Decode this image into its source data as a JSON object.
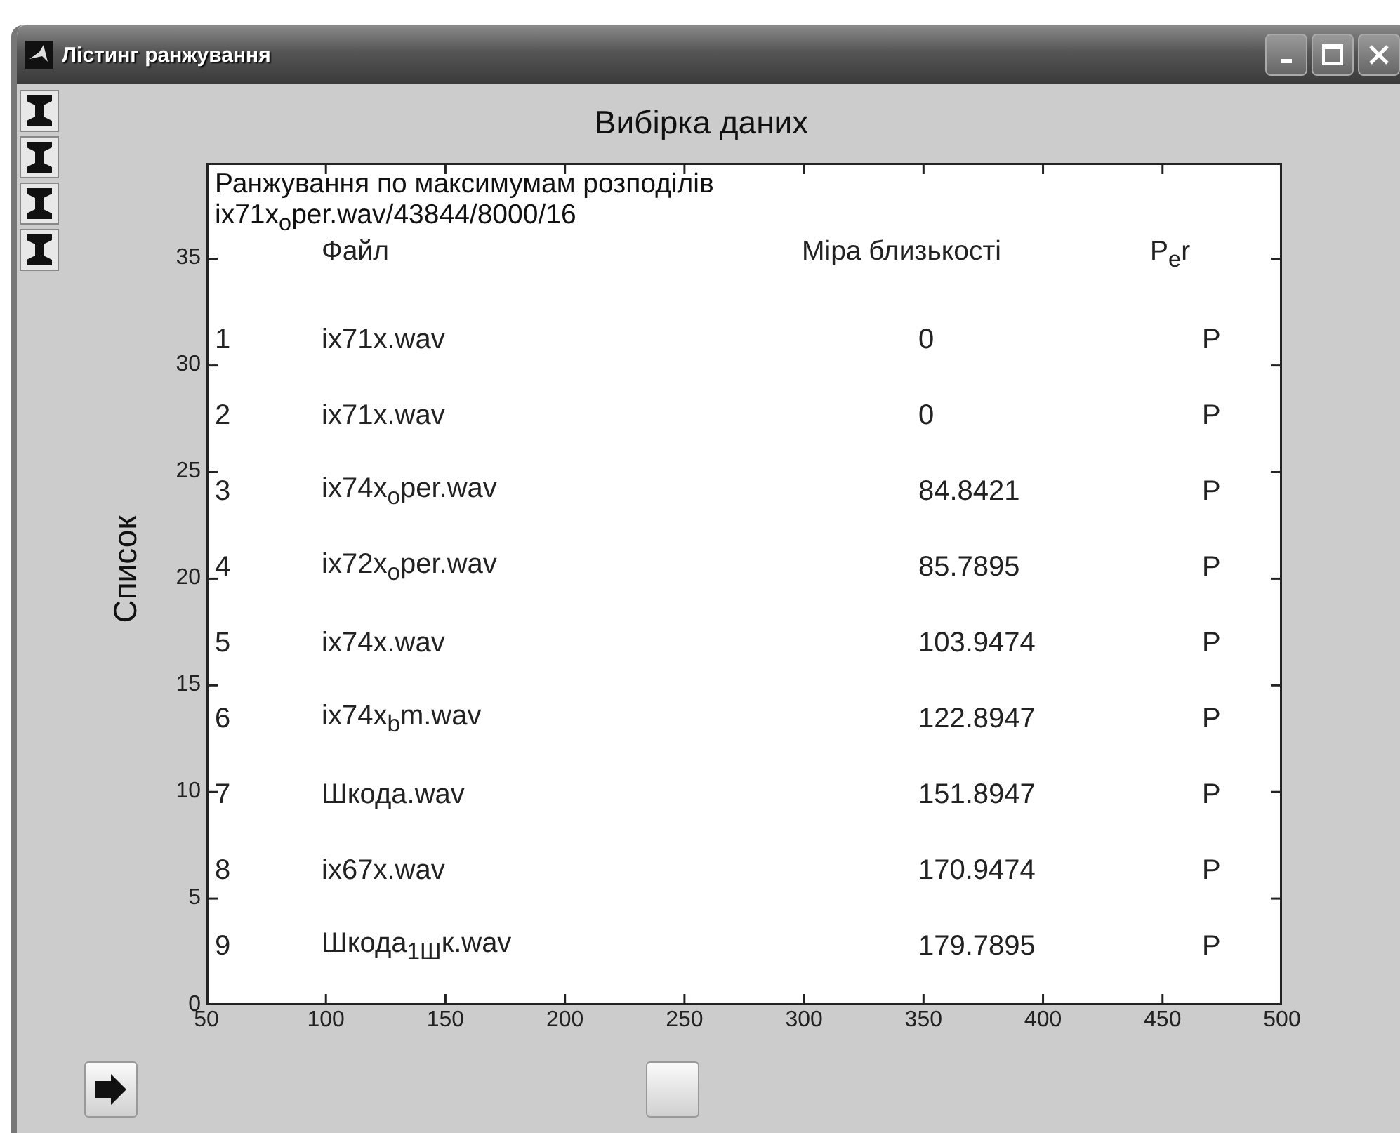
{
  "window": {
    "title": "Лістинг ранжування"
  },
  "plot": {
    "title": "Вибірка даних",
    "ylabel": "Список",
    "xticks": [
      "50",
      "100",
      "150",
      "200",
      "250",
      "300",
      "350",
      "400",
      "450",
      "500"
    ],
    "yticks": [
      "35",
      "30",
      "25",
      "20",
      "15",
      "10",
      "5",
      "0"
    ],
    "heading": [
      "Ранжування по максимумам розподілів",
      "ix71x$_{o}$per.wav/43844/8000/16"
    ],
    "columns": [
      "Файл",
      "Міра близькості",
      "P$_{e}$r"
    ],
    "rows": [
      {
        "rank": "1",
        "file": "ix71x.wav",
        "measure": "0",
        "flag": "P"
      },
      {
        "rank": "2",
        "file": "ix71x.wav",
        "measure": "0",
        "flag": "P"
      },
      {
        "rank": "3",
        "file": "ix74x$_{o}$per.wav",
        "measure": "84.8421",
        "flag": "P"
      },
      {
        "rank": "4",
        "file": "ix72x$_{o}$per.wav",
        "measure": "85.7895",
        "flag": "P"
      },
      {
        "rank": "5",
        "file": "ix74x.wav",
        "measure": "103.9474",
        "flag": "P"
      },
      {
        "rank": "6",
        "file": "ix74x$_{b}$m.wav",
        "measure": "122.8947",
        "flag": "P"
      },
      {
        "rank": "7",
        "file": "Шкода.wav",
        "measure": "151.8947",
        "flag": "P"
      },
      {
        "rank": "8",
        "file": "ix67x.wav",
        "measure": "170.9474",
        "flag": "P"
      },
      {
        "rank": "9",
        "file": "Шкода$_{1Ш}$к.wav",
        "measure": "179.7895",
        "flag": "P"
      }
    ]
  }
}
